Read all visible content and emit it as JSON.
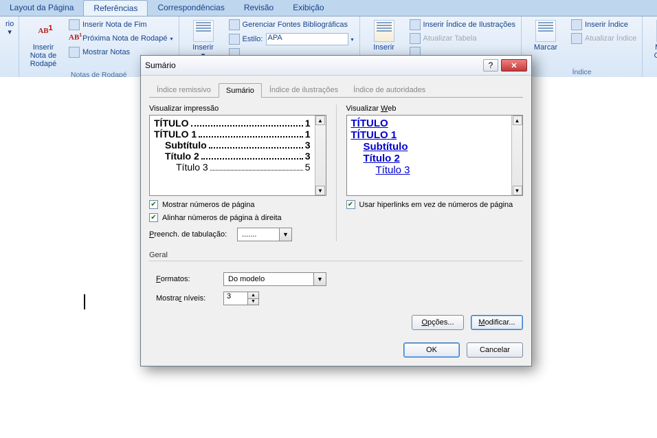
{
  "ribbon_tabs": {
    "layout": "Layout da Página",
    "referencias": "Referências",
    "correspondencias": "Correspondências",
    "revisao": "Revisão",
    "exibicao": "Exibição"
  },
  "ribbon": {
    "rio_btn": "rio",
    "notas": {
      "big": "Inserir Nota de Rodapé",
      "inserir_fim": "Inserir Nota de Fim",
      "proxima": "Próxima Nota de Rodapé",
      "mostrar": "Mostrar Notas",
      "group": "Notas de Rodapé"
    },
    "citacoes": {
      "inserir": "Inserir",
      "gerenciar": "Gerenciar Fontes Bibliográficas",
      "estilo_label": "Estilo:",
      "estilo_value": "APA"
    },
    "legendas": {
      "inserir": "Inserir",
      "inserir_indice_ilustr": "Inserir Índice de Ilustrações",
      "atualizar_tabela": "Atualizar Tabela"
    },
    "indice": {
      "marcar": "Marcar",
      "inserir_indice": "Inserir Índice",
      "atualizar_indice": "Atualizar Índice",
      "group": "Índice"
    },
    "citacao": {
      "marcar": "Marcar Citação"
    }
  },
  "dialog": {
    "title": "Sumário",
    "tabs": {
      "indice_remissivo": "Índice remissivo",
      "sumario": "Sumário",
      "indice_ilustracoes": "Índice de ilustrações",
      "indice_autoridades": "Índice de autoridades"
    },
    "print_preview_label": "Visualizar impressão",
    "web_preview_label_pre": "Visualizar ",
    "web_preview_label_u": "W",
    "web_preview_label_post": "eb",
    "print_rows": [
      {
        "text": "TÍTULO",
        "page": "1",
        "bold": true,
        "indent": 0
      },
      {
        "text": "TÍTULO 1",
        "page": "1",
        "bold": true,
        "indent": 0
      },
      {
        "text": "Subtítulo",
        "page": "3",
        "bold": true,
        "indent": 1
      },
      {
        "text": "Título 2",
        "page": "3",
        "bold": true,
        "indent": 1
      },
      {
        "text": "Título 3",
        "page": "5",
        "bold": false,
        "indent": 2
      }
    ],
    "web_rows": [
      {
        "text": "TÍTULO",
        "bold": true,
        "indent": 0
      },
      {
        "text": "TÍTULO 1",
        "bold": true,
        "indent": 0
      },
      {
        "text": "Subtítulo",
        "bold": true,
        "indent": 1
      },
      {
        "text": "Título 2",
        "bold": true,
        "indent": 1
      },
      {
        "text": "Título 3",
        "bold": false,
        "indent": 2
      }
    ],
    "chk_show_page": "Mostrar números de página",
    "chk_align_right": "Alinhar números de página à direita",
    "chk_hyperlinks": "Usar hiperlinks em vez de números de página",
    "preench_label_u": "P",
    "preench_label_post": "reench. de tabulação:",
    "preench_value": ".......",
    "geral_label": "Geral",
    "formatos_label_u": "F",
    "formatos_label_post": "ormatos:",
    "formatos_value": "Do modelo",
    "mostrar_label": "Mostra",
    "mostrar_label_u": "r",
    "mostrar_label_post": " níveis:",
    "mostrar_value": "3",
    "btn_opcoes": "Opções...",
    "btn_modificar": "Modificar...",
    "btn_ok": "OK",
    "btn_cancelar": "Cancelar"
  }
}
